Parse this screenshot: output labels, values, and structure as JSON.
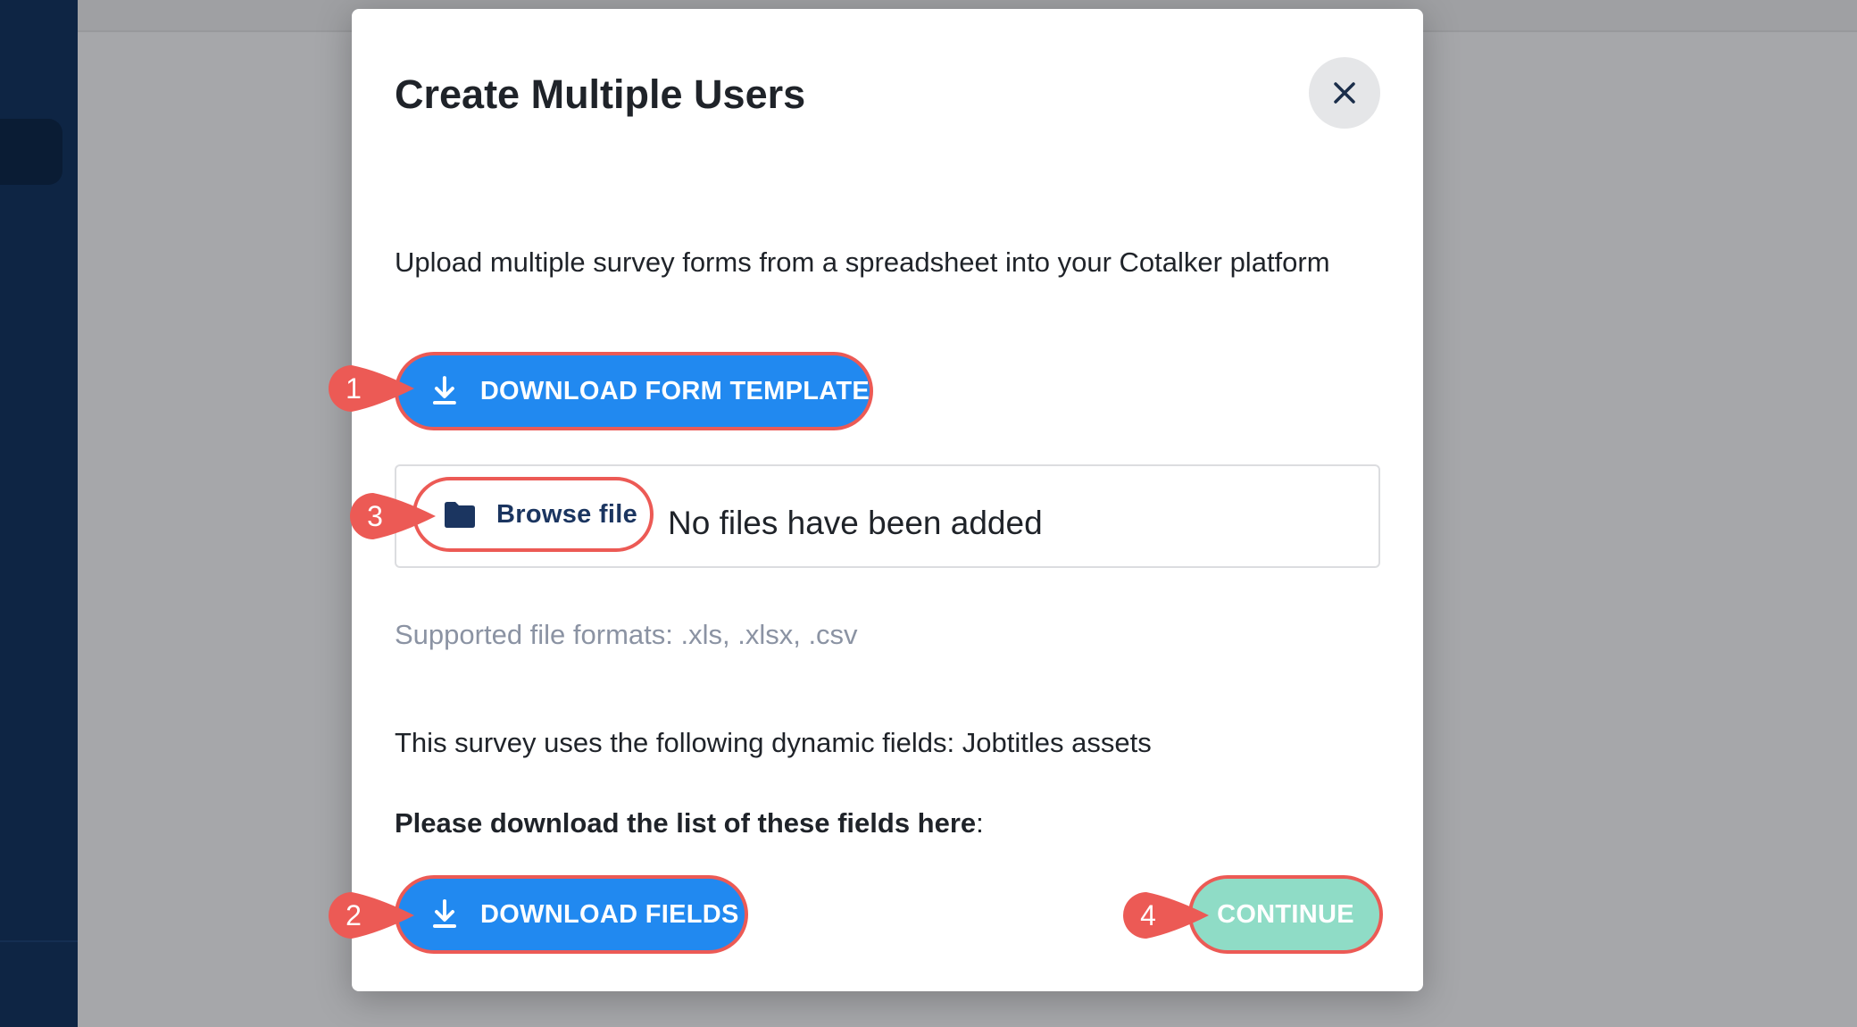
{
  "modal": {
    "title": "Create Multiple Users",
    "intro": "Upload multiple survey forms from a spreadsheet into your Cotalker platform",
    "download_template_label": "DOWNLOAD FORM TEMPLATE",
    "browse_label": "Browse file",
    "no_files_text": "No files have been added",
    "supported_formats": "Supported file formats: .xls, .xlsx, .csv",
    "dynamic_fields_text": "This survey uses the following dynamic fields: Jobtitles assets",
    "download_list_bold": "Please download the list of these fields here",
    "download_list_suffix": ":",
    "download_fields_label": "DOWNLOAD FIELDS",
    "continue_label": "CONTINUE"
  },
  "callouts": [
    {
      "number": "1"
    },
    {
      "number": "2"
    },
    {
      "number": "3"
    },
    {
      "number": "4"
    }
  ],
  "colors": {
    "primary": "#2189f0",
    "callout": "#ec5a55",
    "continue": "#8fdcc6",
    "sidebar": "#0e2544"
  },
  "icons": {
    "close": "close-icon",
    "download": "download-icon",
    "folder": "folder-icon"
  }
}
